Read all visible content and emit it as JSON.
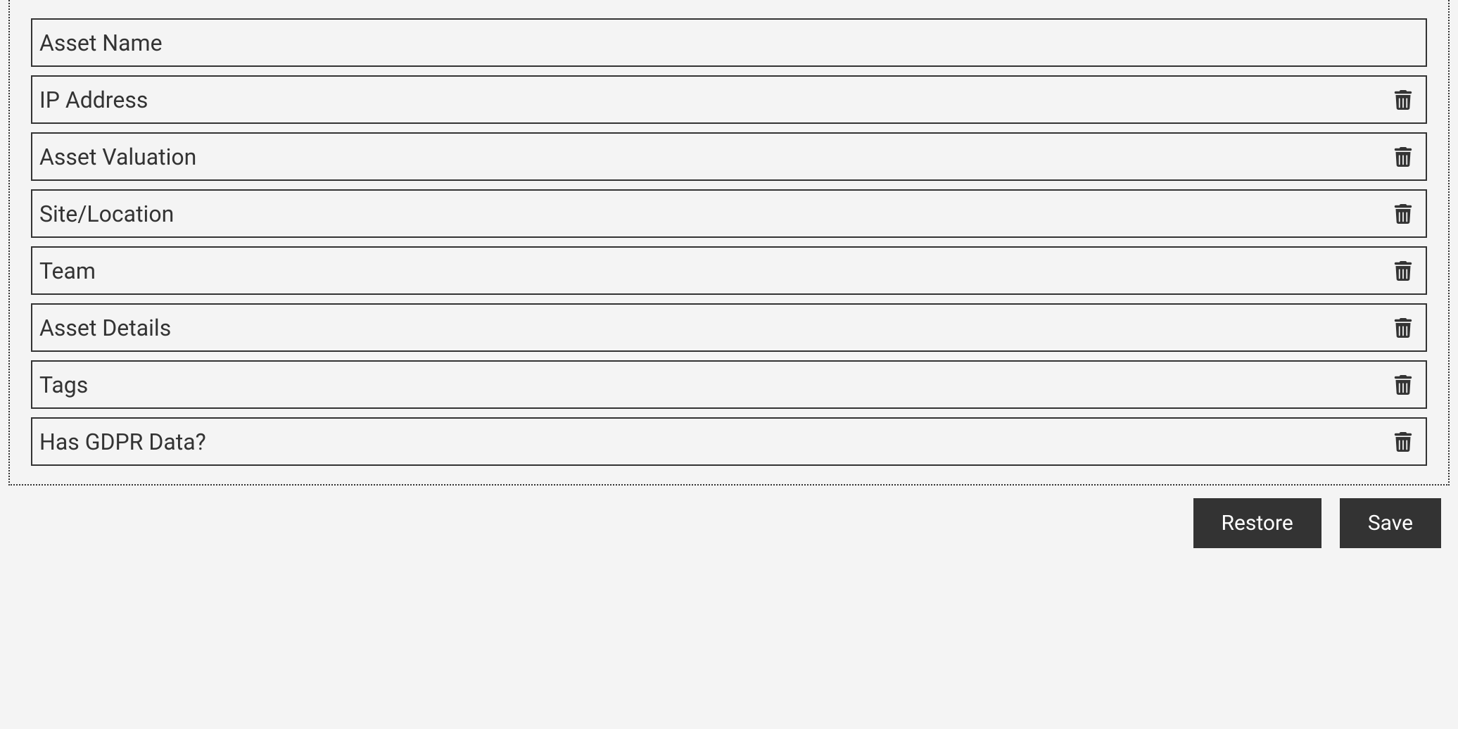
{
  "fields": [
    {
      "label": "Asset Name",
      "deletable": false
    },
    {
      "label": "IP Address",
      "deletable": true
    },
    {
      "label": "Asset Valuation",
      "deletable": true
    },
    {
      "label": "Site/Location",
      "deletable": true
    },
    {
      "label": "Team",
      "deletable": true
    },
    {
      "label": "Asset Details",
      "deletable": true
    },
    {
      "label": "Tags",
      "deletable": true
    },
    {
      "label": "Has GDPR Data?",
      "deletable": true
    }
  ],
  "actions": {
    "restore_label": "Restore",
    "save_label": "Save"
  }
}
